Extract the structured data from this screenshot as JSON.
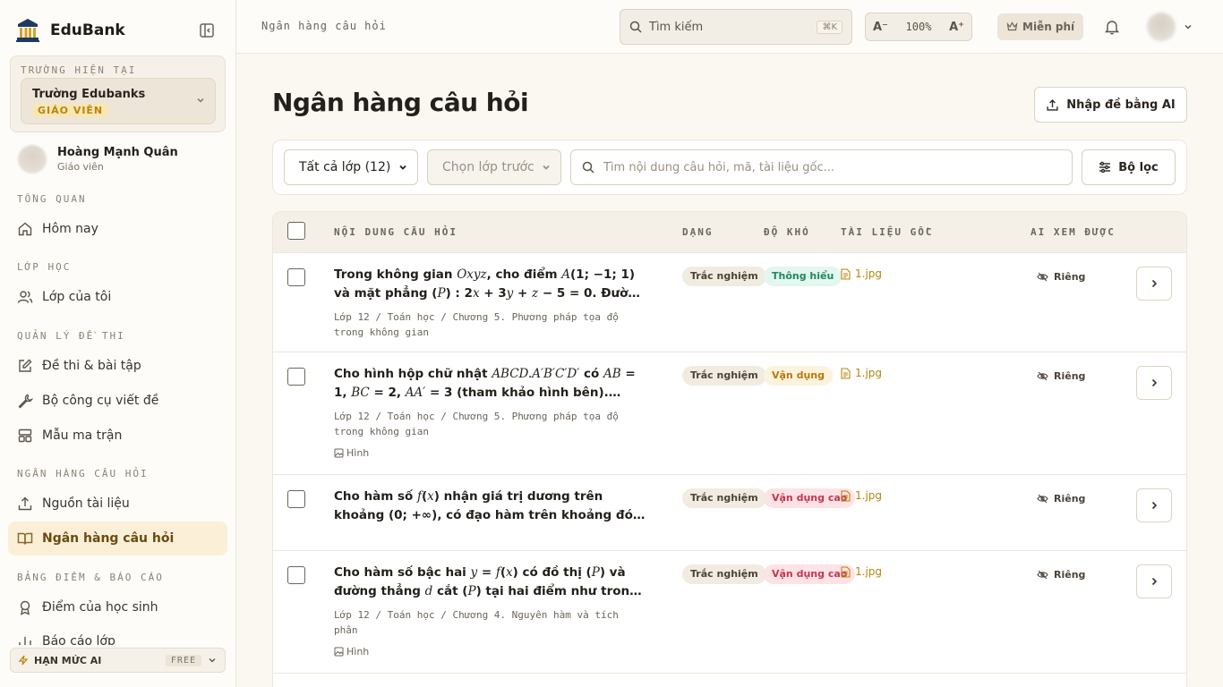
{
  "sidebar": {
    "brand": "EduBank",
    "school_caption": "TRƯỜNG HIỆN TẠI",
    "school_name": "Trường Edubanks",
    "role": "GIÁO VIÊN",
    "user_name": "Hoàng Mạnh Quân",
    "user_role": "Giáo viên",
    "sections": {
      "overview": "TỔNG QUAN",
      "classes": "LỚP HỌC",
      "exams": "QUẢN LÝ ĐỀ THI",
      "bank": "NGÂN HÀNG CÂU HỎI",
      "reports": "BẢNG ĐIỂM & BÁO CÁO"
    },
    "items": {
      "today": "Hôm nay",
      "my_classes": "Lớp của tôi",
      "exams": "Đề thi & bài tập",
      "tools": "Bộ công cụ viết đề",
      "matrix": "Mẫu ma trận",
      "sources": "Nguồn tài liệu",
      "bank": "Ngân hàng câu hỏi",
      "scores": "Điểm của học sinh",
      "class_reports": "Báo cáo lớp"
    },
    "quota_label": "HẠN MỨC AI",
    "quota_plan": "FREE"
  },
  "topbar": {
    "breadcrumb": "Ngân hàng câu hỏi",
    "search_placeholder": "Tìm kiếm",
    "shortcut": "⌘K",
    "zoom_out": "A⁻",
    "zoom": "100%",
    "zoom_in": "A⁺",
    "plan": "Miễn phí"
  },
  "page": {
    "title": "Ngân hàng câu hỏi",
    "ai_import": "Nhập đề bằng AI"
  },
  "filters": {
    "grade": "Tất cả lớp (12)",
    "class": "Chọn lớp trước",
    "search_placeholder": "Tìm nội dung câu hỏi, mã, tài liệu gốc...",
    "filter_button": "Bộ lọc"
  },
  "table": {
    "headers": {
      "content": "NỘI DUNG CÂU HỎI",
      "type": "DẠNG",
      "difficulty": "ĐỘ KHÓ",
      "source": "TÀI LIỆU GỐC",
      "visibility": "AI XEM ĐƯỢC"
    },
    "rows": [
      {
        "path": "Lớp 12 / Toán học / Chương 5. Phương pháp tọa độ trong không gian",
        "type": "Trắc nghiệm",
        "difficulty": "Thông hiểu",
        "file": "1.jpg",
        "visibility": "Riêng"
      },
      {
        "path": "Lớp 12 / Toán học / Chương 5. Phương pháp tọa độ trong không gian",
        "tag": "Hình",
        "type": "Trắc nghiệm",
        "difficulty": "Vận dụng",
        "file": "1.jpg",
        "visibility": "Riêng"
      },
      {
        "type": "Trắc nghiệm",
        "difficulty": "Vận dụng cao",
        "file": "1.jpg",
        "visibility": "Riêng"
      },
      {
        "path": "Lớp 12 / Toán học / Chương 4. Nguyên hàm và tích phân",
        "tag": "Hình",
        "type": "Trắc nghiệm",
        "difficulty": "Vận dụng cao",
        "file": "1.jpg",
        "visibility": "Riêng"
      }
    ]
  },
  "colors": {
    "accent": "#b8860b",
    "active_nav_bg": "#fbefd8",
    "easy": "#1e8a60",
    "medium": "#b47a10",
    "hard": "#c23752"
  }
}
